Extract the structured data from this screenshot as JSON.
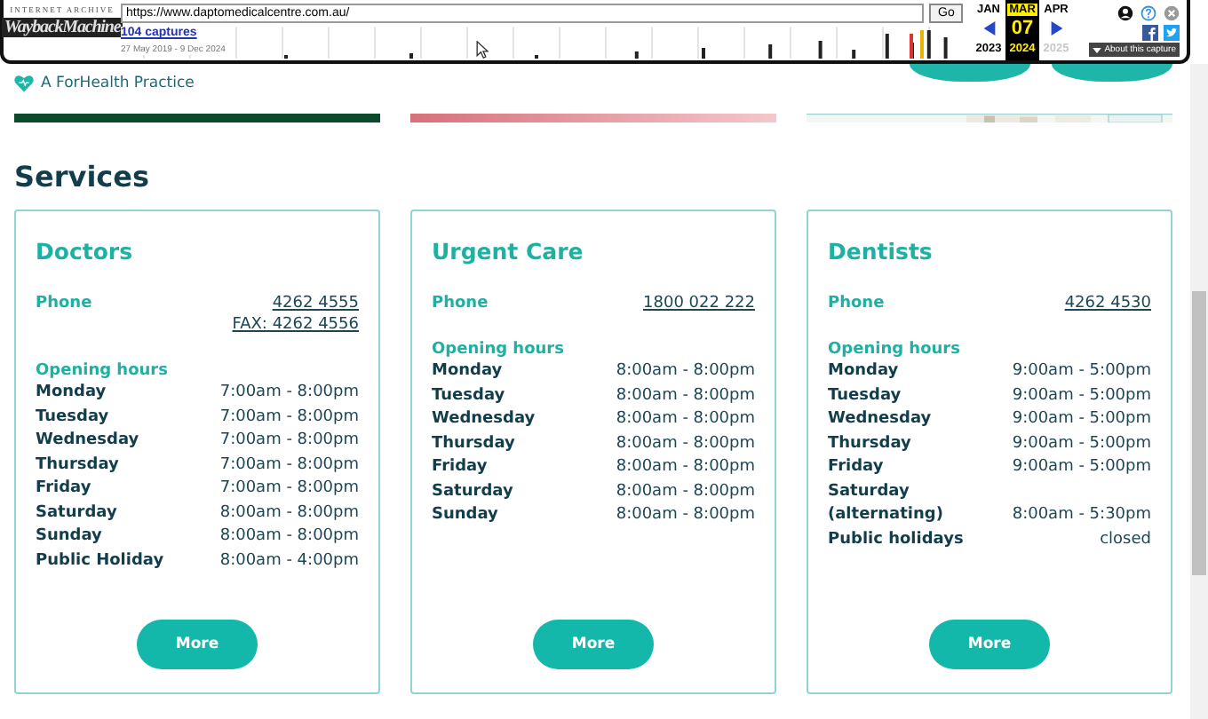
{
  "toolbar": {
    "logo_top": "INTERNET ARCHIVE",
    "logo": "WaybackMachine",
    "url": "https://www.daptomedicalcentre.com.au/",
    "go": "Go",
    "captures": "104 captures",
    "range": "27 May 2019 - 9 Dec 2024",
    "months": [
      {
        "month": "JAN",
        "year": "2023",
        "selected": false,
        "disabled": false
      },
      {
        "month": "MAR",
        "day": "07",
        "year": "2024",
        "selected": true,
        "disabled": false
      },
      {
        "month": "APR",
        "year": "2025",
        "selected": false,
        "disabled": true
      }
    ],
    "about": "About this capture"
  },
  "site": {
    "brand": "A ForHealth Practice"
  },
  "services": {
    "title": "Services",
    "cards": [
      {
        "title": "Doctors",
        "phone_label": "Phone",
        "phones": [
          "4262 4555",
          "FAX: 4262 4556"
        ],
        "hours_label": "Opening hours",
        "hours": [
          {
            "day": "Monday",
            "time": "7:00am - 8:00pm"
          },
          {
            "day": "Tuesday",
            "time": "7:00am - 8:00pm"
          },
          {
            "day": "Wednesday",
            "time": "7:00am - 8:00pm"
          },
          {
            "day": "Thursday",
            "time": "7:00am - 8:00pm"
          },
          {
            "day": "Friday",
            "time": "7:00am - 8:00pm"
          },
          {
            "day": "Saturday",
            "time": "8:00am - 8:00pm"
          },
          {
            "day": "Sunday",
            "time": "8:00am - 8:00pm"
          },
          {
            "day": "Public Holiday",
            "time": "8:00am - 4:00pm"
          }
        ],
        "button": "More"
      },
      {
        "title": "Urgent Care",
        "phone_label": "Phone",
        "phones": [
          "1800 022 222"
        ],
        "hours_label": "Opening hours",
        "hours": [
          {
            "day": "Monday",
            "time": "8:00am - 8:00pm"
          },
          {
            "day": "Tuesday",
            "time": "8:00am - 8:00pm"
          },
          {
            "day": "Wednesday",
            "time": "8:00am - 8:00pm"
          },
          {
            "day": "Thursday",
            "time": "8:00am - 8:00pm"
          },
          {
            "day": "Friday",
            "time": "8:00am - 8:00pm"
          },
          {
            "day": "Saturday",
            "time": "8:00am - 8:00pm"
          },
          {
            "day": "Sunday",
            "time": "8:00am - 8:00pm"
          }
        ],
        "button": "More"
      },
      {
        "title": "Dentists",
        "phone_label": "Phone",
        "phones": [
          "4262 4530"
        ],
        "hours_label": "Opening hours",
        "hours": [
          {
            "day": "Monday",
            "time": "9:00am - 5:00pm"
          },
          {
            "day": "Tuesday",
            "time": "9:00am - 5:00pm"
          },
          {
            "day": "Wednesday",
            "time": "9:00am - 5:00pm"
          },
          {
            "day": "Thursday",
            "time": "9:00am - 5:00pm"
          },
          {
            "day": "Friday",
            "time": "9:00am - 5:00pm"
          },
          {
            "day": "Saturday (alternating)",
            "time": "8:00am - 5:30pm"
          },
          {
            "day": "Public holidays",
            "time": "closed"
          }
        ],
        "button": "More"
      }
    ]
  }
}
